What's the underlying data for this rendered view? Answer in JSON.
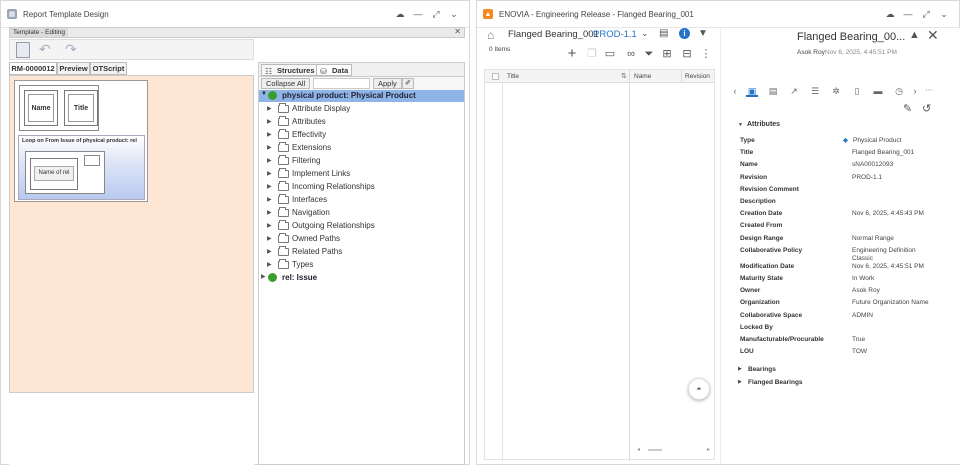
{
  "left_window": {
    "title": "Report Template Design",
    "mode_label": "Template - Editing",
    "tabs": [
      "RM-0000012",
      "Preview",
      "OTScript"
    ],
    "canvas": {
      "name_box": "Name",
      "title_box": "Title",
      "loop_label": "Loop on From Issue of physical product: rel",
      "rel_box": "Name of rel"
    },
    "data_tabs": [
      "Structures",
      "Data"
    ],
    "collapse_label": "Collapse All",
    "apply_label": "Apply",
    "tree_root": "physical product: Physical Product",
    "tree_items": [
      "Attribute Display",
      "Attributes",
      "Effectivity",
      "Extensions",
      "Filtering",
      "Implement Links",
      "Incoming Relationships",
      "Interfaces",
      "Navigation",
      "Outgoing Relationships",
      "Owned Paths",
      "Related Paths",
      "Types"
    ],
    "tree_rel": "rel: Issue"
  },
  "right_window": {
    "title": "ENOVIA - Engineering Release - Flanged Bearing_001",
    "header_item": "Flanged Bearing_001",
    "header_revision": "PROD-1.1",
    "items_count": "0 Items",
    "columns": [
      "Title",
      "Name",
      "Revision"
    ],
    "details_title": "Flanged Bearing_00...",
    "details_owner": "Asok Roy",
    "details_date": "Nov 6, 2025, 4:45:51 PM",
    "section_attributes": "Attributes",
    "attributes": [
      {
        "label": "Type",
        "value": "Physical Product"
      },
      {
        "label": "Title",
        "value": "Flanged Bearing_001"
      },
      {
        "label": "Name",
        "value": "sNA00012093"
      },
      {
        "label": "Revision",
        "value": "PROD-1.1"
      },
      {
        "label": "Revision Comment",
        "value": ""
      },
      {
        "label": "Description",
        "value": ""
      },
      {
        "label": "Creation Date",
        "value": "Nov 6, 2025, 4:45:43 PM"
      },
      {
        "label": "Created From",
        "value": ""
      },
      {
        "label": "Design Range",
        "value": "Normal Range"
      },
      {
        "label": "Collaborative Policy",
        "value": "Engineering Definition Classic"
      },
      {
        "label": "Modification Date",
        "value": "Nov 6, 2025, 4:45:51 PM"
      },
      {
        "label": "Maturity State",
        "value": "In Work"
      },
      {
        "label": "Owner",
        "value": "Asok Roy"
      },
      {
        "label": "Organization",
        "value": "Future Organization Name"
      },
      {
        "label": "Collaborative Space",
        "value": "ADMIN"
      },
      {
        "label": "Locked By",
        "value": ""
      },
      {
        "label": "Manufacturable/Procurable",
        "value": "True"
      },
      {
        "label": "LOU",
        "value": "TOW"
      }
    ],
    "sections_collapsed": [
      "Bearings",
      "Flanged Bearings"
    ]
  },
  "colors": {
    "tree_selection": "#8fb4e8",
    "canvas_bg": "#fde7d4",
    "enovia_orange": "#f58a1f",
    "link_blue": "#2573c7"
  }
}
